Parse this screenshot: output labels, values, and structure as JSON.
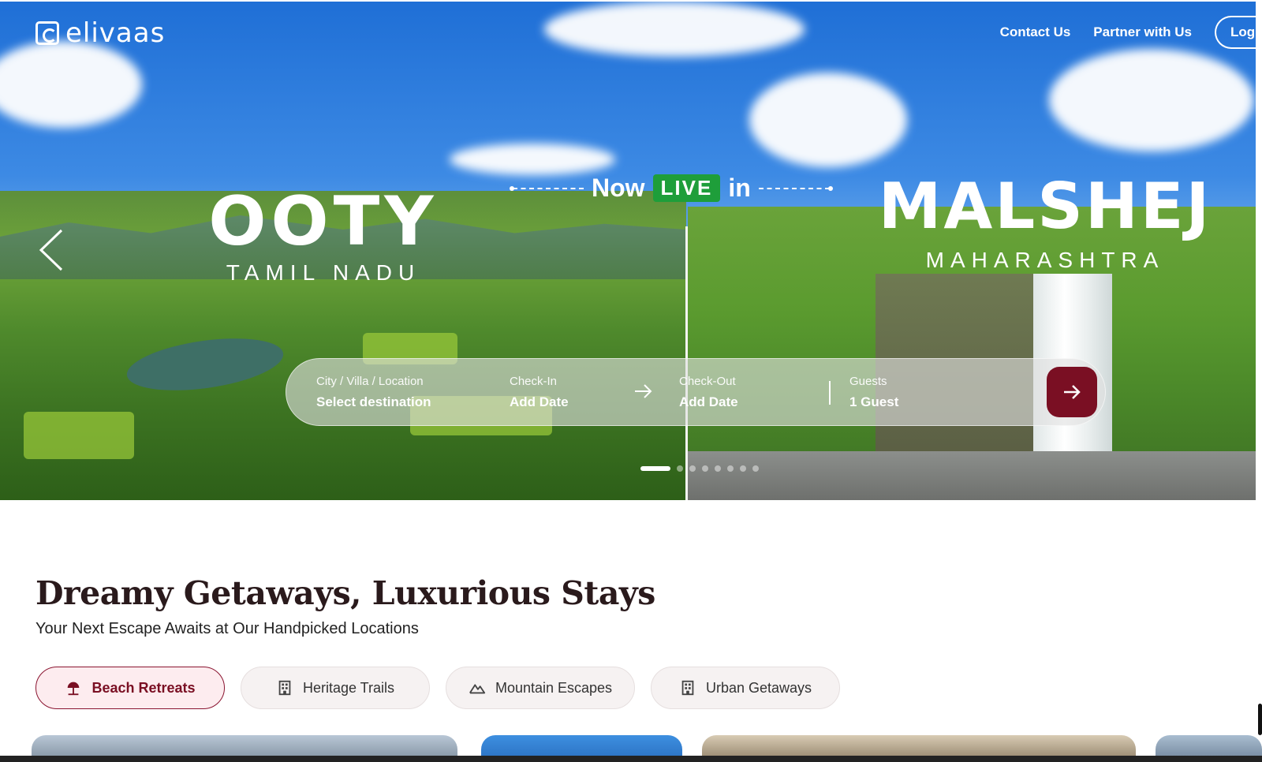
{
  "brand": {
    "logo_text": "elivaas",
    "logo_icon": "home-e-logo-icon"
  },
  "nav": {
    "contact": "Contact Us",
    "partner": "Partner with Us",
    "login": "Log"
  },
  "hero": {
    "now": "Now",
    "live": "LIVE",
    "in": "in",
    "left_city": "OOTY",
    "left_state": "TAMIL NADU",
    "right_city": "MALSHEJ",
    "right_state": "MAHARASHTRA",
    "carousel_dots": 8,
    "active_dot": 1
  },
  "search": {
    "location_label": "City / Villa / Location",
    "location_value": "Select destination",
    "checkin_label": "Check-In",
    "checkin_value": "Add Date",
    "checkout_label": "Check-Out",
    "checkout_value": "Add Date",
    "guests_label": "Guests",
    "guests_value": "1 Guest",
    "submit_icon": "arrow-right-icon"
  },
  "section": {
    "title": "Dreamy Getaways, Luxurious Stays",
    "subtitle": "Your Next Escape Awaits at Our Handpicked Locations"
  },
  "categories": [
    {
      "label": "Beach Retreats",
      "icon": "beach-umbrella-icon",
      "active": true
    },
    {
      "label": "Heritage Trails",
      "icon": "building-icon",
      "active": false
    },
    {
      "label": "Mountain Escapes",
      "icon": "mountain-icon",
      "active": false
    },
    {
      "label": "Urban Getaways",
      "icon": "building-icon",
      "active": false
    }
  ],
  "colors": {
    "accent": "#7a0f23",
    "live_green": "#1e9e3a",
    "chip_active_bg": "#fdecef"
  }
}
